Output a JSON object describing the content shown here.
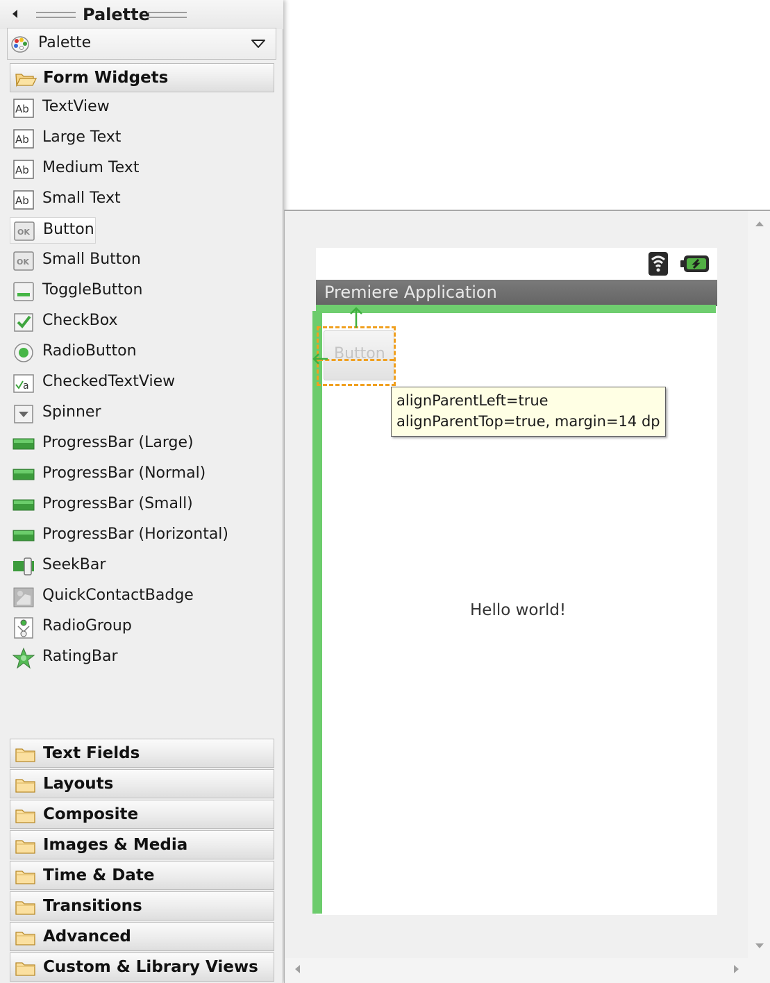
{
  "palette": {
    "title": "Palette",
    "header_label": "Palette",
    "open_category": "Form Widgets",
    "widgets": [
      {
        "label": "TextView",
        "icon": "text-ab-icon"
      },
      {
        "label": "Large Text",
        "icon": "text-ab-icon"
      },
      {
        "label": "Medium Text",
        "icon": "text-ab-icon"
      },
      {
        "label": "Small Text",
        "icon": "text-ab-icon"
      },
      {
        "label": "Button",
        "icon": "ok-button-icon",
        "selected": true
      },
      {
        "label": "Small Button",
        "icon": "ok-button-icon"
      },
      {
        "label": "ToggleButton",
        "icon": "toggle-button-icon"
      },
      {
        "label": "CheckBox",
        "icon": "checkbox-icon"
      },
      {
        "label": "RadioButton",
        "icon": "radio-button-icon"
      },
      {
        "label": "CheckedTextView",
        "icon": "checked-text-icon"
      },
      {
        "label": "Spinner",
        "icon": "spinner-icon"
      },
      {
        "label": "ProgressBar (Large)",
        "icon": "progress-bar-icon"
      },
      {
        "label": "ProgressBar (Normal)",
        "icon": "progress-bar-icon"
      },
      {
        "label": "ProgressBar (Small)",
        "icon": "progress-bar-icon"
      },
      {
        "label": "ProgressBar (Horizontal)",
        "icon": "progress-bar-icon"
      },
      {
        "label": "SeekBar",
        "icon": "seekbar-icon"
      },
      {
        "label": "QuickContactBadge",
        "icon": "contact-badge-icon"
      },
      {
        "label": "RadioGroup",
        "icon": "radio-group-icon"
      },
      {
        "label": "RatingBar",
        "icon": "star-icon"
      }
    ],
    "collapsed_categories": [
      "Text Fields",
      "Layouts",
      "Composite",
      "Images & Media",
      "Time & Date",
      "Transitions",
      "Advanced",
      "Custom & Library Views"
    ]
  },
  "device": {
    "action_bar_title": "Premiere Application",
    "button_label": "Button",
    "hello_text": "Hello world!",
    "status_icons": [
      "wifi-icon",
      "battery-icon"
    ],
    "accent_color": "#6fce6f",
    "selection_color": "#f0a020"
  },
  "tooltip": {
    "line1": "alignParentLeft=true",
    "line2": "alignParentTop=true, margin=14 dp"
  }
}
